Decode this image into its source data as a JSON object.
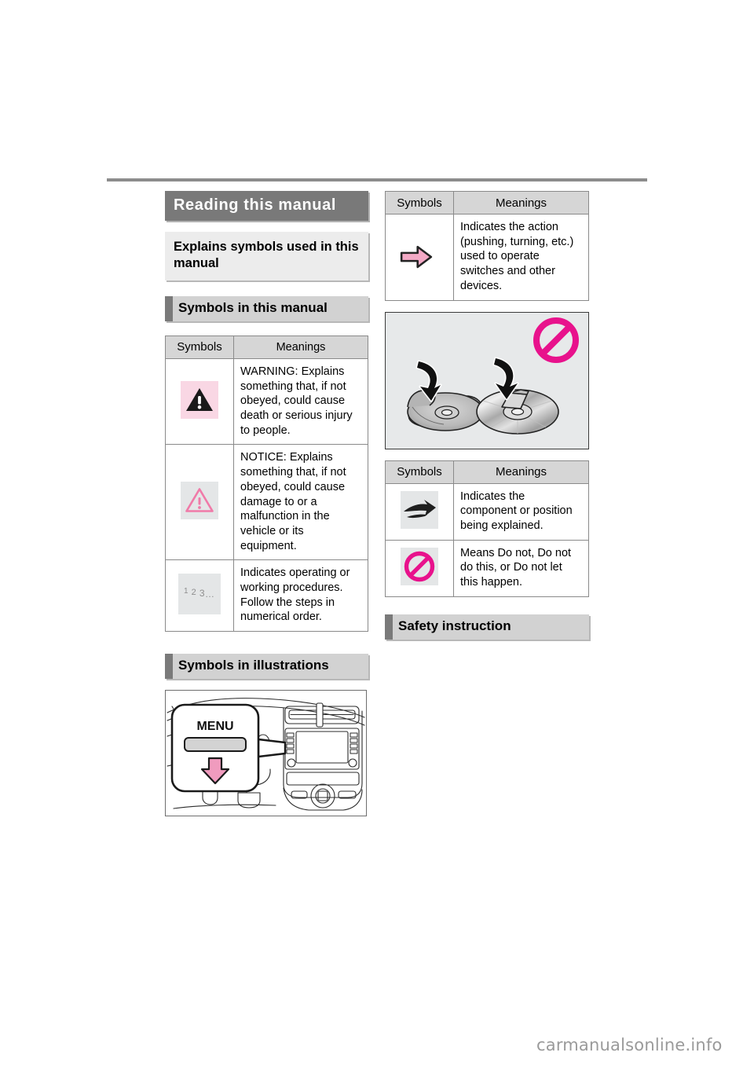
{
  "document": {
    "watermark": "carmanualsonline.info"
  },
  "left_column": {
    "chapter_title": "Reading this manual",
    "subject_box": "Explains symbols used in this manual",
    "section_heading": "Symbols in this manual",
    "symbols_table": {
      "headers": [
        "Symbols",
        "Meanings"
      ],
      "rows": [
        {
          "symbol": "warning-triangle-filled",
          "meaning": "WARNING:\nExplains something that, if not obeyed, could cause death or serious injury to people."
        },
        {
          "symbol": "notice-triangle-outline",
          "meaning": "NOTICE:\nExplains something that, if not obeyed, could cause damage to or a malfunction in the vehicle or its equipment."
        },
        {
          "symbol": "numbered-steps",
          "symbol_text": "1 2 3 ...",
          "meaning": "Indicates operating or working procedures. Follow the steps in numerical order."
        }
      ]
    },
    "illustration_section_heading": "Symbols in illustrations",
    "illustration": {
      "name": "dashboard-menu-button-illustration",
      "callout_label": "MENU"
    }
  },
  "right_column": {
    "action_table": {
      "headers": [
        "Symbols",
        "Meanings"
      ],
      "rows": [
        {
          "symbol": "pink-block-arrow",
          "meaning": "Indicates the action (pushing, turning, etc.) used to operate switches and other devices."
        }
      ]
    },
    "disc_illustration": {
      "name": "do-not-stack-or-tape-discs-illustration",
      "prohibition_badge": "prohibition-circle"
    },
    "indicator_table": {
      "headers": [
        "Symbols",
        "Meanings"
      ],
      "rows": [
        {
          "symbol": "swoosh-arrow",
          "meaning": "Indicates the component or position being explained."
        },
        {
          "symbol": "prohibition-circle",
          "meaning": "Means Do not, Do not do this, or Do not let this happen."
        }
      ]
    },
    "safety_section_heading": "Safety instruction"
  },
  "colors": {
    "chapter_bar_bg": "#797979",
    "subject_box_bg": "#ececec",
    "section_head_bg": "#d2d2d2",
    "section_accent": "#7a7a7a",
    "table_header_bg": "#d6d6d6",
    "pink_accent": "#f09bbe",
    "magenta_accent": "#e8128c",
    "pink_tile_bg": "#f9d7e4",
    "grey_tile_bg": "#e4e6e7",
    "watermark": "#9a9a9a"
  }
}
